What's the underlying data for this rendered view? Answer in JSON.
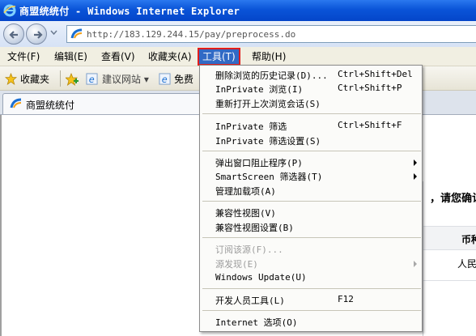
{
  "window": {
    "title": "商盟统统付 - Windows Internet Explorer"
  },
  "address": {
    "url": "http://183.129.244.15/pay/preprocess.do"
  },
  "menubar": [
    {
      "label": "文件(F)"
    },
    {
      "label": "编辑(E)"
    },
    {
      "label": "查看(V)"
    },
    {
      "label": "收藏夹(A)"
    },
    {
      "label": "工具(T)"
    },
    {
      "label": "帮助(H)"
    }
  ],
  "favorites": {
    "favorites_label": "收藏夹",
    "suggested_sites": "建议网站 ▾",
    "free_item": "免费"
  },
  "tab": {
    "title": "商盟统统付"
  },
  "page": {
    "confirm_text": "，请您确认",
    "header_partial": "币种",
    "cell_partial": "人民"
  },
  "tools_menu": {
    "items": [
      {
        "label": "删除浏览的历史记录(D)...",
        "shortcut": "Ctrl+Shift+Del",
        "disabled": false,
        "submenu": false
      },
      {
        "label": "InPrivate 浏览(I)",
        "shortcut": "Ctrl+Shift+P",
        "disabled": false,
        "submenu": false
      },
      {
        "label": "重新打开上次浏览会话(S)",
        "shortcut": "",
        "disabled": false,
        "submenu": false
      },
      {
        "label": "InPrivate 筛选",
        "shortcut": "Ctrl+Shift+F",
        "disabled": false,
        "submenu": false
      },
      {
        "label": "InPrivate 筛选设置(S)",
        "shortcut": "",
        "disabled": false,
        "submenu": false
      },
      {
        "label": "弹出窗口阻止程序(P)",
        "shortcut": "",
        "disabled": false,
        "submenu": true
      },
      {
        "label": "SmartScreen 筛选器(T)",
        "shortcut": "",
        "disabled": false,
        "submenu": true
      },
      {
        "label": "管理加载项(A)",
        "shortcut": "",
        "disabled": false,
        "submenu": false
      },
      {
        "label": "兼容性视图(V)",
        "shortcut": "",
        "disabled": false,
        "submenu": false
      },
      {
        "label": "兼容性视图设置(B)",
        "shortcut": "",
        "disabled": false,
        "submenu": false
      },
      {
        "label": "订阅该源(F)...",
        "shortcut": "",
        "disabled": true,
        "submenu": false
      },
      {
        "label": "源发现(E)",
        "shortcut": "",
        "disabled": true,
        "submenu": true
      },
      {
        "label": "Windows Update(U)",
        "shortcut": "",
        "disabled": false,
        "submenu": false
      },
      {
        "label": "开发人员工具(L)",
        "shortcut": "F12",
        "disabled": false,
        "submenu": false
      },
      {
        "label": "Internet 选项(O)",
        "shortcut": "",
        "disabled": false,
        "submenu": false
      }
    ]
  },
  "colors": {
    "titlebar": "#0a54d8",
    "menu_highlight": "#316ac5",
    "highlight_outline": "#e11d1d",
    "disabled_text": "#9c9c9c"
  }
}
